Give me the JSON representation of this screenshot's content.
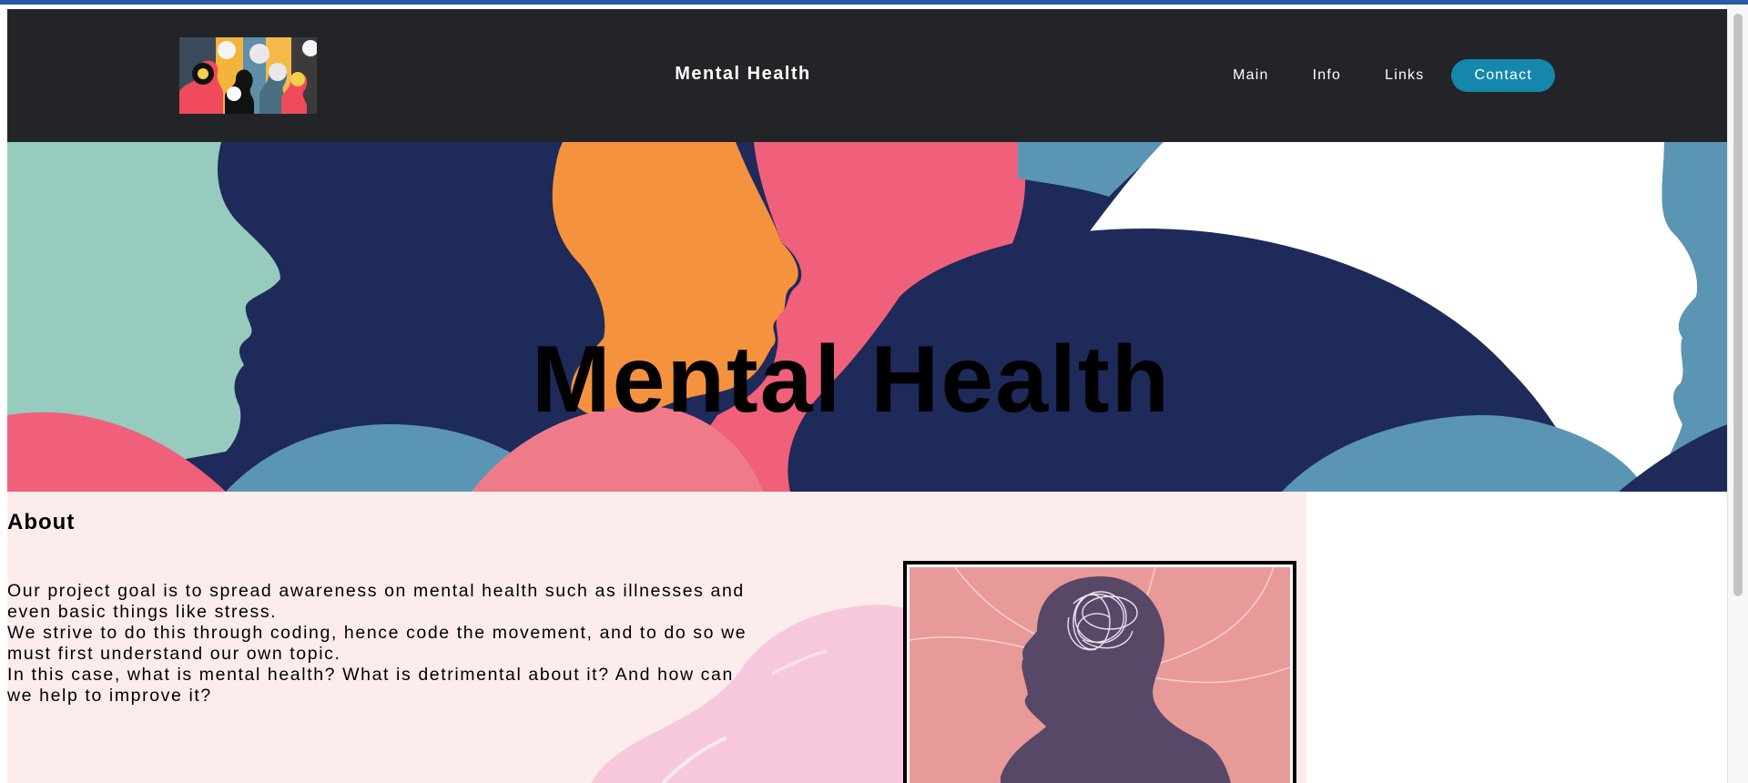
{
  "navbar": {
    "logo_alt": "colorful silhouettes of heads",
    "site_title": "Mental Health",
    "links": [
      {
        "label": "Main"
      },
      {
        "label": "Info"
      },
      {
        "label": "Links"
      },
      {
        "label": "Contact"
      }
    ]
  },
  "hero": {
    "title": "Mental Health",
    "illustration": "overlapping-head-silhouettes"
  },
  "about": {
    "heading": "About",
    "paragraphs": [
      "Our project goal is to spread awareness on mental health such as illnesses and even basic things like stress.",
      "We strive to do this through coding, hence code the movement, and to do so we must first understand our own topic.",
      "In this case, what is mental health? What is detrimental about it? And how can we help to improve it?"
    ],
    "image_alt": "head silhouette with tangled thoughts"
  },
  "colors": {
    "navbar_bg": "#232428",
    "contact_button": "#1587ad",
    "about_bg": "#fcecec",
    "hero_navy": "#1e2a5a",
    "hero_teal": "#96cbbd",
    "hero_orange": "#f5923e",
    "hero_pink": "#f0607a",
    "hero_blue": "#5b95b4"
  }
}
